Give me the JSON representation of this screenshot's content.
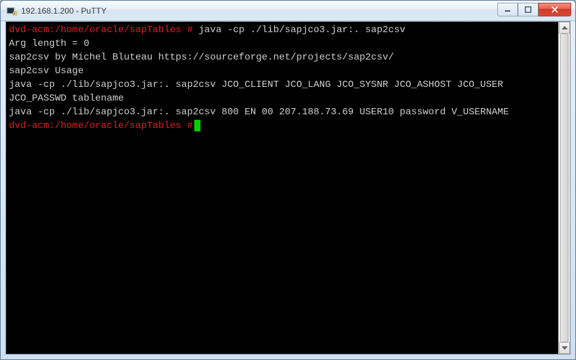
{
  "window": {
    "title": "192.168.1.200 - PuTTY"
  },
  "terminal": {
    "prompt1": "dvd-acm:/home/oracle/sapTables #",
    "command1": " java -cp ./lib/sapjco3.jar:. sap2csv",
    "line2": "Arg length = 0",
    "line3": "sap2csv by Michel Bluteau https://sourceforge.net/projects/sap2csv/",
    "line4": "sap2csv Usage",
    "line5": "java -cp ./lib/sapjco3.jar:. sap2csv JCO_CLIENT JCO_LANG JCO_SYSNR JCO_ASHOST JCO_USER JCO_PASSWD tablename",
    "line6": "java -cp ./lib/sapjco3.jar:. sap2csv 800 EN 00 207.188.73.69 USER10 password V_USERNAME",
    "prompt2": "dvd-acm:/home/oracle/sapTables #"
  }
}
